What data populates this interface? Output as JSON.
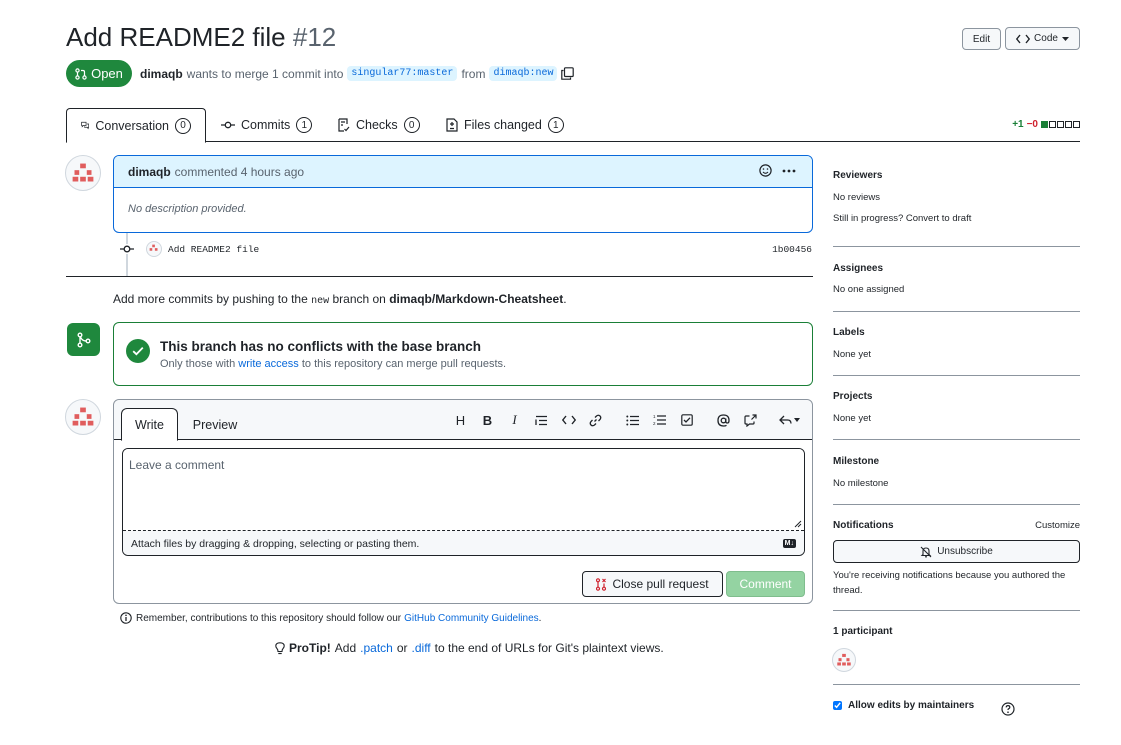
{
  "header": {
    "title": "Add README2 file",
    "number": "#12",
    "edit_label": "Edit",
    "code_label": "Code"
  },
  "state": {
    "label": "Open",
    "author": "dimaqb",
    "merge_text": "wants to merge 1 commit into",
    "base_branch": "singular77:master",
    "from_text": "from",
    "head_branch": "dimaqb:new"
  },
  "tabs": [
    {
      "label": "Conversation",
      "count": "0"
    },
    {
      "label": "Commits",
      "count": "1"
    },
    {
      "label": "Checks",
      "count": "0"
    },
    {
      "label": "Files changed",
      "count": "1"
    }
  ],
  "diffstat": {
    "additions": "+1",
    "deletions": "−0"
  },
  "comment": {
    "author": "dimaqb",
    "action": "commented 4 hours ago",
    "body": "No description provided."
  },
  "commit": {
    "message": "Add README2 file",
    "sha": "1b00456"
  },
  "push_hint": {
    "prefix": "Add more commits by pushing to the",
    "branch": "new",
    "middle": "branch on",
    "repo": "dimaqb/Markdown-Cheatsheet",
    "suffix": "."
  },
  "merge": {
    "title": "This branch has no conflicts with the base branch",
    "sub_prefix": "Only those with",
    "sub_link": "write access",
    "sub_suffix": "to this repository can merge pull requests."
  },
  "editor": {
    "write_tab": "Write",
    "preview_tab": "Preview",
    "placeholder": "Leave a comment",
    "attach_text": "Attach files by dragging & dropping, selecting or pasting them.",
    "md_badge": "M↓",
    "close_label": "Close pull request",
    "submit_label": "Comment",
    "toolbar": [
      "H",
      "B",
      "I"
    ]
  },
  "guidelines": {
    "prefix": "Remember, contributions to this repository should follow our",
    "link": "GitHub Community Guidelines",
    "suffix": "."
  },
  "protip": {
    "label": "ProTip!",
    "prefix": "Add",
    "patch": ".patch",
    "or": "or",
    "diff": ".diff",
    "suffix": "to the end of URLs for Git's plaintext views."
  },
  "sidebar": {
    "reviewers": {
      "heading": "Reviewers",
      "value": "No reviews",
      "extra_prefix": "Still in progress?",
      "extra_link": "Convert to draft"
    },
    "assignees": {
      "heading": "Assignees",
      "value": "No one assigned"
    },
    "labels": {
      "heading": "Labels",
      "value": "None yet"
    },
    "projects": {
      "heading": "Projects",
      "value": "None yet"
    },
    "milestone": {
      "heading": "Milestone",
      "value": "No milestone"
    },
    "notifications": {
      "heading": "Notifications",
      "customize": "Customize",
      "button": "Unsubscribe",
      "text": "You're receiving notifications because you authored the thread."
    },
    "participants": {
      "heading": "1 participant"
    },
    "allow_edits": {
      "label": "Allow edits by maintainers",
      "checked": true
    }
  },
  "colors": {
    "accent": "#0969da",
    "success": "#1f883d",
    "avatar_dots": "#e05d5d"
  }
}
